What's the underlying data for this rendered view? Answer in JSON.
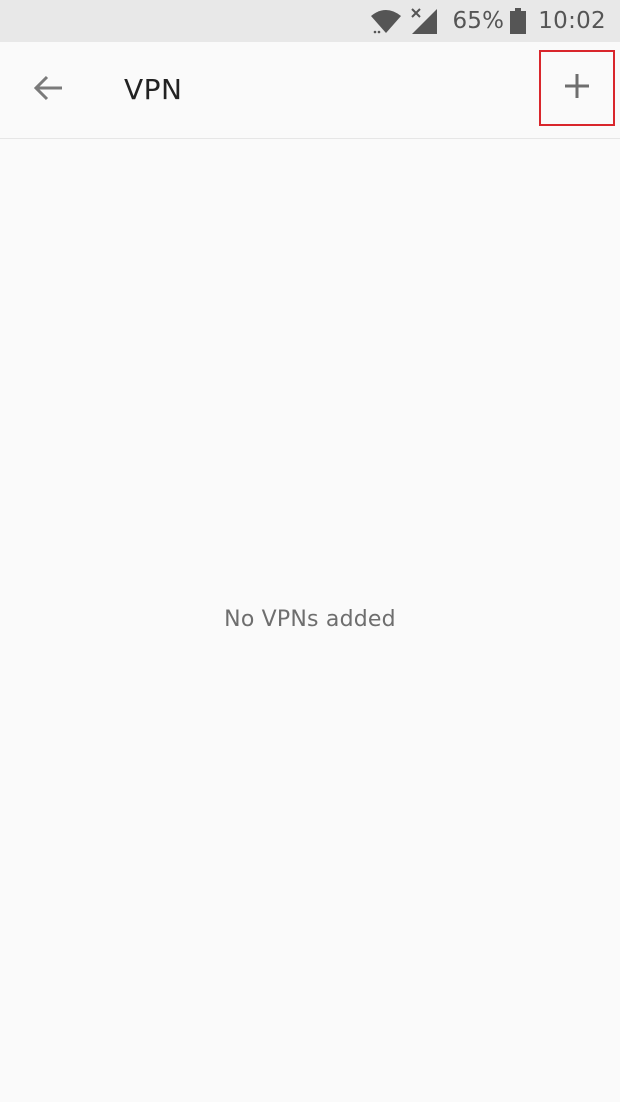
{
  "status_bar": {
    "battery_percent": "65%",
    "time": "10:02",
    "icons": [
      "wifi-icon",
      "signal-icon",
      "battery-icon"
    ]
  },
  "toolbar": {
    "title": "VPN",
    "back_icon": "arrow-left-icon",
    "add_icon": "plus-icon",
    "highlight_color": "#d9262c"
  },
  "content": {
    "empty_message": "No VPNs added"
  }
}
